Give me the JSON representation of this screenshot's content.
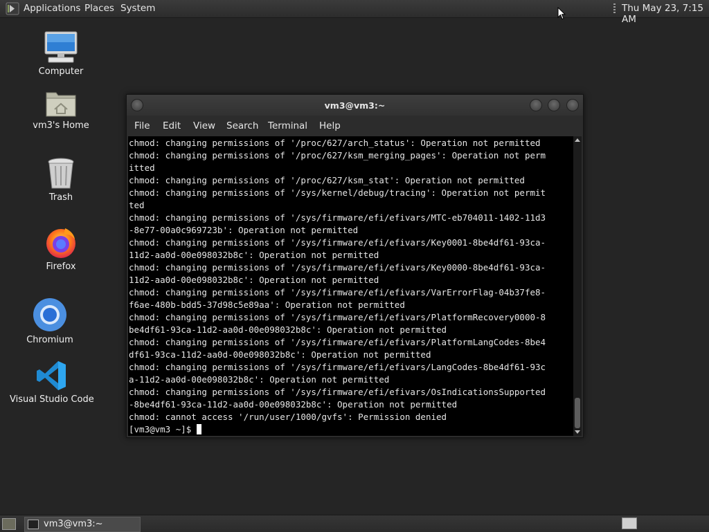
{
  "top_panel": {
    "menus": [
      "Applications",
      "Places",
      "System"
    ],
    "clock": "Thu May 23,  7:15 AM"
  },
  "desktop": {
    "icons": [
      {
        "label": "Computer",
        "icon": "computer-icon"
      },
      {
        "label": "vm3's Home",
        "icon": "home-folder-icon"
      },
      {
        "label": "Trash",
        "icon": "trash-icon"
      },
      {
        "label": "Firefox",
        "icon": "firefox-icon"
      },
      {
        "label": "Chromium",
        "icon": "chromium-icon"
      },
      {
        "label": "Visual Studio Code",
        "icon": "vscode-icon"
      }
    ]
  },
  "terminal": {
    "title": "vm3@vm3:~",
    "menu": [
      "File",
      "Edit",
      "View",
      "Search",
      "Terminal",
      "Help"
    ],
    "lines": [
      "chmod: changing permissions of '/proc/627/arch_status': Operation not permitted",
      "chmod: changing permissions of '/proc/627/ksm_merging_pages': Operation not perm",
      "itted",
      "chmod: changing permissions of '/proc/627/ksm_stat': Operation not permitted",
      "chmod: changing permissions of '/sys/kernel/debug/tracing': Operation not permit",
      "ted",
      "chmod: changing permissions of '/sys/firmware/efi/efivars/MTC-eb704011-1402-11d3",
      "-8e77-00a0c969723b': Operation not permitted",
      "chmod: changing permissions of '/sys/firmware/efi/efivars/Key0001-8be4df61-93ca-",
      "11d2-aa0d-00e098032b8c': Operation not permitted",
      "chmod: changing permissions of '/sys/firmware/efi/efivars/Key0000-8be4df61-93ca-",
      "11d2-aa0d-00e098032b8c': Operation not permitted",
      "chmod: changing permissions of '/sys/firmware/efi/efivars/VarErrorFlag-04b37fe8-",
      "f6ae-480b-bdd5-37d98c5e89aa': Operation not permitted",
      "chmod: changing permissions of '/sys/firmware/efi/efivars/PlatformRecovery0000-8",
      "be4df61-93ca-11d2-aa0d-00e098032b8c': Operation not permitted",
      "chmod: changing permissions of '/sys/firmware/efi/efivars/PlatformLangCodes-8be4",
      "df61-93ca-11d2-aa0d-00e098032b8c': Operation not permitted",
      "chmod: changing permissions of '/sys/firmware/efi/efivars/LangCodes-8be4df61-93c",
      "a-11d2-aa0d-00e098032b8c': Operation not permitted",
      "chmod: changing permissions of '/sys/firmware/efi/efivars/OsIndicationsSupported",
      "-8be4df61-93ca-11d2-aa0d-00e098032b8c': Operation not permitted",
      "chmod: cannot access '/run/user/1000/gvfs': Permission denied"
    ],
    "prompt": "[vm3@vm3 ~]$ "
  },
  "taskbar": {
    "task_label": "vm3@vm3:~"
  }
}
